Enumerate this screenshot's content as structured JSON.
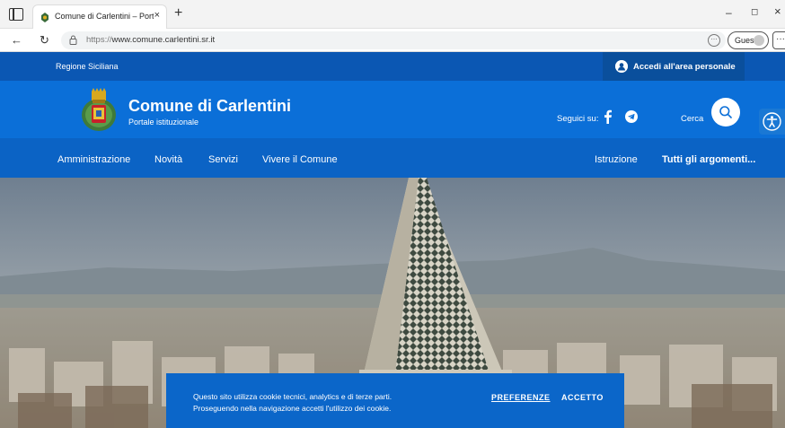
{
  "browser": {
    "tab_title": "Comune di Carlentini – Portale isti",
    "tab_close": "×",
    "new_tab": "+",
    "minimize": "–",
    "maximize": "◻",
    "close": "×",
    "back": "←",
    "reload": "↻",
    "url_protocol": "https://",
    "url_host": "www.comune.carlentini.sr.it",
    "guest_label": "Guest",
    "more": "···"
  },
  "header": {
    "region": "Regione Siciliana",
    "login": "Accedi all'area personale",
    "title": "Comune di Carlentini",
    "subtitle": "Portale istituzionale",
    "social_label": "Seguici su:",
    "search_label": "Cerca"
  },
  "nav": {
    "items": [
      "Amministrazione",
      "Novità",
      "Servizi",
      "Vivere il Comune"
    ],
    "right_items": [
      "Istruzione",
      "Tutti gli argomenti..."
    ]
  },
  "cookie": {
    "text_line1": "Questo sito utilizza cookie tecnici, analytics e di terze parti.",
    "text_line2": "Proseguendo nella navigazione accetti l'utilizzo dei cookie.",
    "preferences": "PREFERENZE",
    "accept": "ACCETTO"
  },
  "colors": {
    "slim_header": "#0b57b3",
    "header": "#0b6fd8",
    "navbar": "#0b63c5",
    "cookie": "#0b66c9"
  },
  "icons": [
    "sidebar-icon",
    "favicon-icon",
    "lock-icon",
    "reader-icon",
    "user-icon",
    "crest-icon",
    "facebook-icon",
    "telegram-icon",
    "search-icon",
    "accessibility-icon"
  ]
}
